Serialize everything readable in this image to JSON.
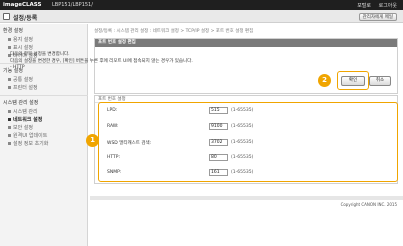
{
  "header": {
    "brand": "imageCLASS",
    "model": "LBP151/LBP151/",
    "links": [
      "포털로",
      "로그아웃"
    ]
  },
  "titlebar": {
    "title": "설정/등록",
    "admin_button": "관리자에게 메일"
  },
  "sidebar": {
    "sections": [
      {
        "label": "환경 설정",
        "items": [
          "용지 설정",
          "표시 설정",
          "타이머 설정"
        ]
      },
      {
        "label": "기능 설정",
        "items": [
          "공통 설정",
          "프린터 설정"
        ]
      },
      {
        "label": "시스템 관리 설정",
        "items": [
          "시스템 관리",
          "네트워크 설정",
          "보안 설정",
          "원격UI 업데이트",
          "설정 정보 초기화"
        ]
      }
    ],
    "active_item": "네트워크 설정"
  },
  "breadcrumb": "설정/등록 : 시스템 관리 설정 : 네트워크 설정 > TCP/IP 설정 > 포트 번호 설정 편집",
  "panel": {
    "title": "포트 번호 설정 편집",
    "messages": [
      "다음의 항목 설정을 변경합니다.",
      "다음의 설정을 변경한 경우, [확인] 버튼을 누른 후에 리모트 UI에 접속되지 않는 경우가 있습니다.",
      "- HTTP"
    ],
    "ok_button": "확인",
    "cancel_button": "취소"
  },
  "ports": {
    "heading": "포트 번호 설정",
    "rows": [
      {
        "label": "LPD:",
        "value": "515",
        "range": "(1-65535)"
      },
      {
        "label": "RAW:",
        "value": "9100",
        "range": "(1-65535)"
      },
      {
        "label": "WSD 멀티캐스트 검색:",
        "value": "3702",
        "range": "(1-65535)"
      },
      {
        "label": "HTTP:",
        "value": "80",
        "range": "(1-65535)"
      },
      {
        "label": "SNMP:",
        "value": "161",
        "range": "(1-65535)"
      }
    ]
  },
  "callouts": [
    "1",
    "2"
  ],
  "footer": {
    "copyright": "Copyright CANON INC. 2015"
  },
  "colors": {
    "callout": "#f0a500",
    "header": "#1f1f1f",
    "panel_head": "#7a7a7a"
  }
}
